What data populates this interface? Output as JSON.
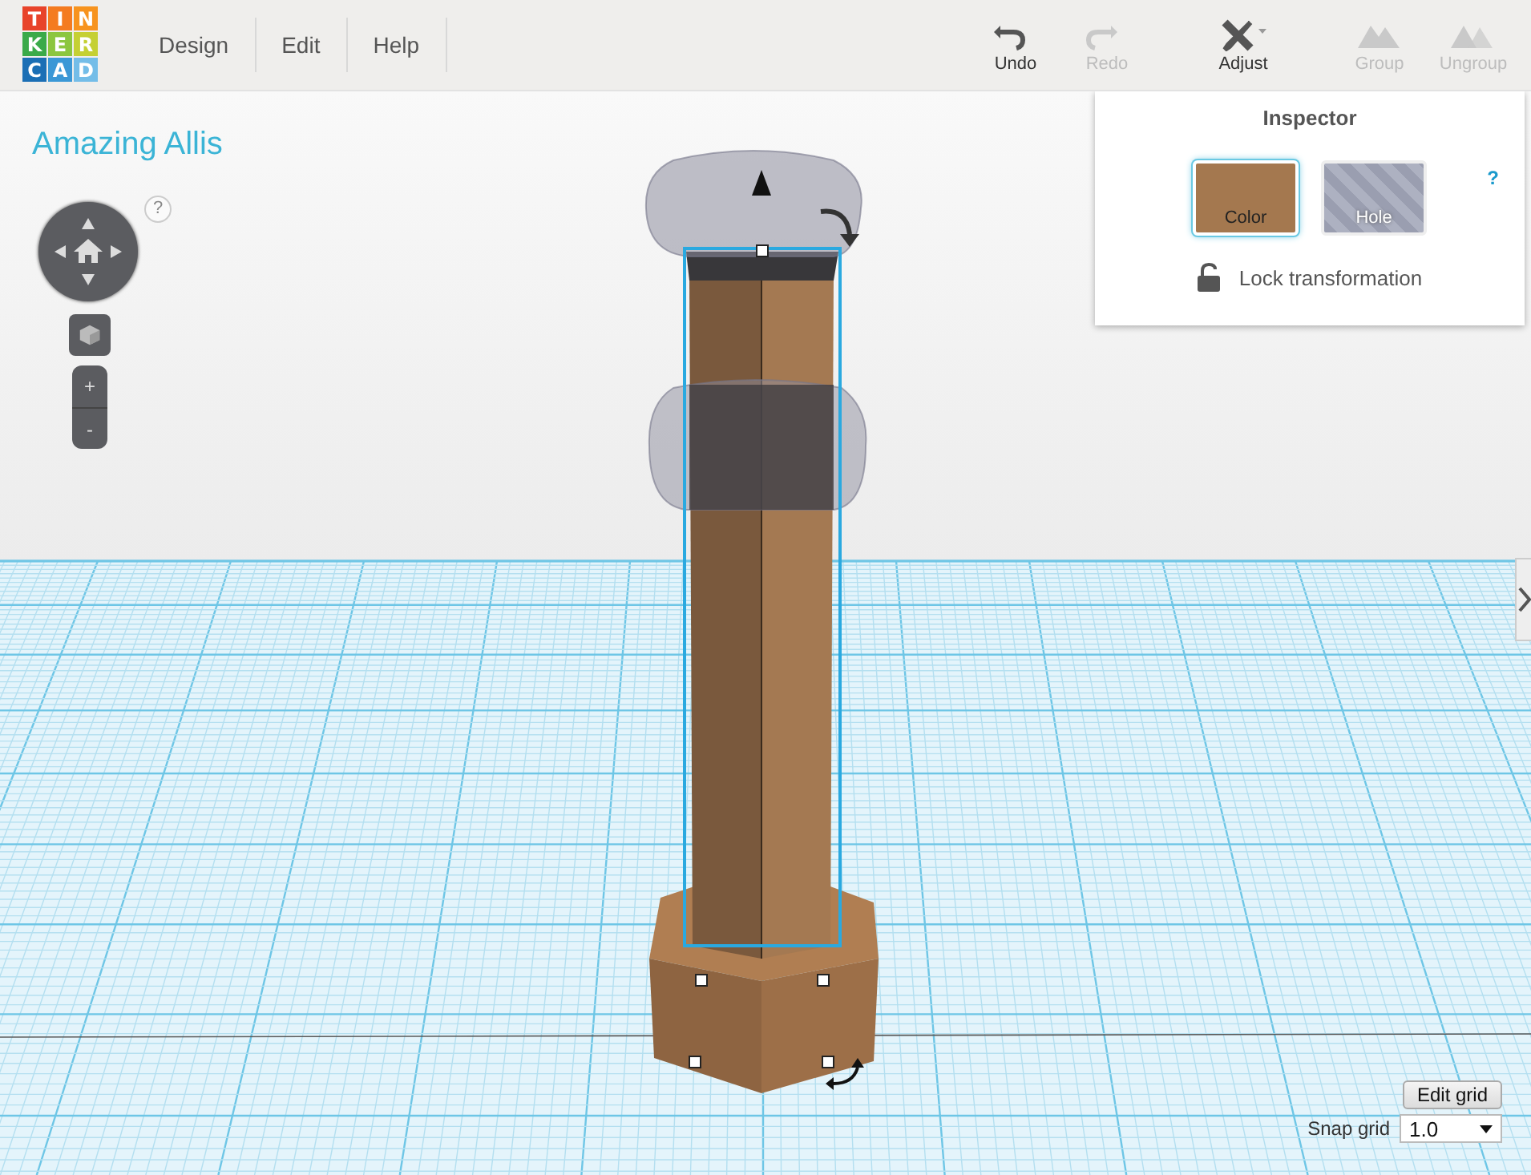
{
  "logo": {
    "tiles": [
      {
        "letter": "T",
        "color": "#e8432a"
      },
      {
        "letter": "I",
        "color": "#f47b20"
      },
      {
        "letter": "N",
        "color": "#f7931e"
      },
      {
        "letter": "K",
        "color": "#3aaa49"
      },
      {
        "letter": "E",
        "color": "#8cc63f"
      },
      {
        "letter": "R",
        "color": "#c5d034"
      },
      {
        "letter": "C",
        "color": "#1b6fb5"
      },
      {
        "letter": "A",
        "color": "#3b98d6"
      },
      {
        "letter": "D",
        "color": "#74bde8"
      }
    ]
  },
  "menu": [
    {
      "label": "Design"
    },
    {
      "label": "Edit"
    },
    {
      "label": "Help"
    }
  ],
  "toolbar": [
    {
      "label": "Undo",
      "kind": "undo",
      "disabled": false
    },
    {
      "label": "Redo",
      "kind": "redo",
      "disabled": true
    },
    {
      "label": "Adjust",
      "kind": "adjust",
      "disabled": false
    },
    {
      "label": "Group",
      "kind": "group",
      "disabled": true
    },
    {
      "label": "Ungroup",
      "kind": "ungroup",
      "disabled": true
    }
  ],
  "design_title": "Amazing Allis",
  "view_help": "?",
  "zoom_controls": [
    "+",
    "-"
  ],
  "inspector": {
    "title": "Inspector",
    "help": "?",
    "options": [
      {
        "label": "Color",
        "kind": "color",
        "selected": true
      },
      {
        "label": "Hole",
        "kind": "hole",
        "selected": false
      }
    ],
    "lock": {
      "label": "Lock transformation",
      "locked": false
    }
  },
  "grid_controls": {
    "edit_button": "Edit grid",
    "snap_label": "Snap grid",
    "snap_value": "1.0"
  }
}
